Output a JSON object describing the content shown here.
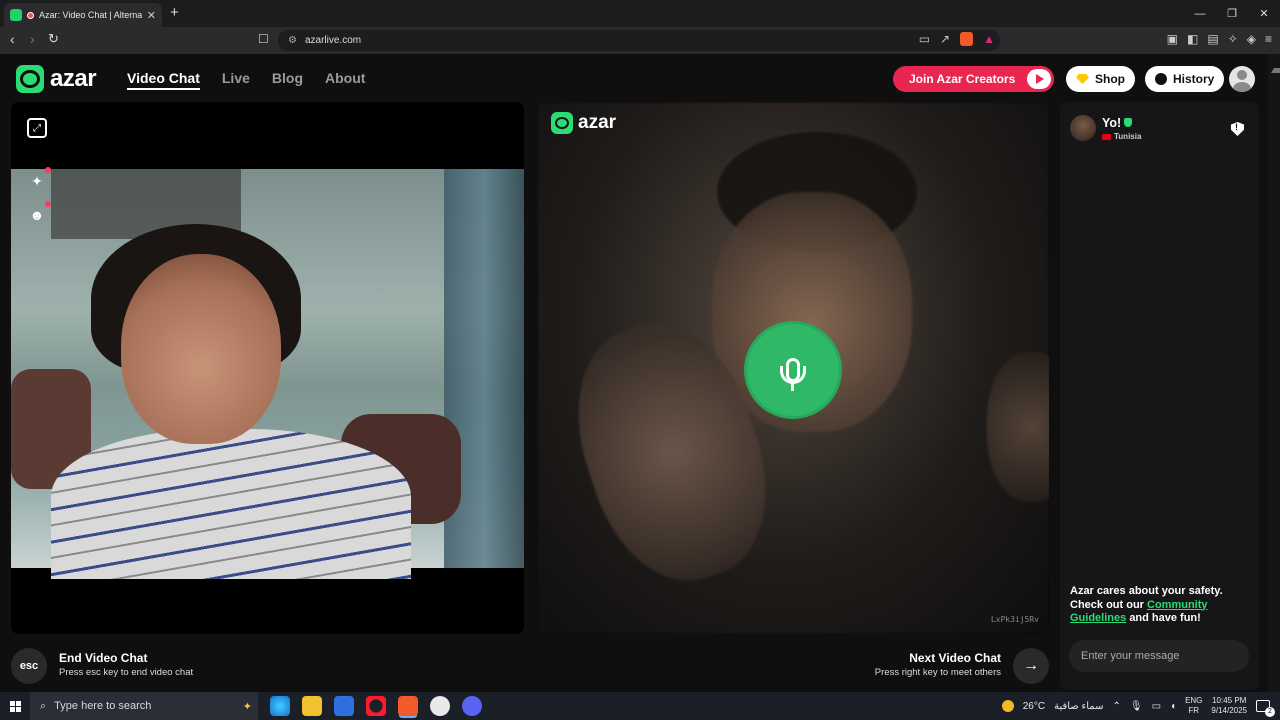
{
  "browser": {
    "tab_title": "Azar: Video Chat | Alternative",
    "tab_close": "✕",
    "new_tab": "+",
    "url": "azarlive.com",
    "window_controls": [
      "—",
      "❐",
      "✕"
    ]
  },
  "site": {
    "logo_text": "azar",
    "nav": [
      {
        "label": "Video Chat",
        "active": true
      },
      {
        "label": "Live",
        "active": false
      },
      {
        "label": "Blog",
        "active": false
      },
      {
        "label": "About",
        "active": false
      }
    ],
    "join_creators": "Join Azar Creators",
    "shop": "Shop",
    "history": "History"
  },
  "video": {
    "remote_logo": "azar",
    "remote_id": "LxPk3ij5Rv",
    "mic_state": "active"
  },
  "controls": {
    "esc_key": "esc",
    "end_title": "End Video Chat",
    "end_sub": "Press esc key to end video chat",
    "next_title": "Next Video Chat",
    "next_sub": "Press right key to meet others",
    "next_arrow": "→"
  },
  "chat": {
    "peer_name": "Yo!",
    "peer_country": "Tunisia",
    "safety_line1": "Azar cares about your safety.",
    "safety_line2": "Check out our",
    "safety_link": "Community Guidelines",
    "safety_line3": "and have fun!",
    "message_placeholder": "Enter your message"
  },
  "taskbar": {
    "search_placeholder": "Type here to search",
    "temperature": "26°C",
    "weather": "سماء صافية",
    "lang_top": "ENG",
    "lang_bottom": "FR",
    "time": "10:45 PM",
    "date": "9/14/2025",
    "notifications": "2"
  },
  "colors": {
    "brand_green": "#2bdc74",
    "creators_red": "#e8264f",
    "mic_green": "#2fb866"
  }
}
